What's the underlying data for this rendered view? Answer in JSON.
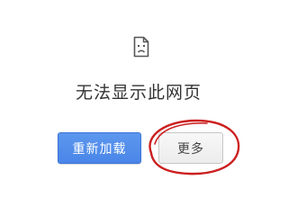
{
  "error": {
    "icon": "sad-page-icon",
    "title": "无法显示此网页"
  },
  "buttons": {
    "reload_label": "重新加载",
    "more_label": "更多"
  },
  "colors": {
    "primary_button": "#4a86e8",
    "annotation": "#cc1f1f"
  }
}
